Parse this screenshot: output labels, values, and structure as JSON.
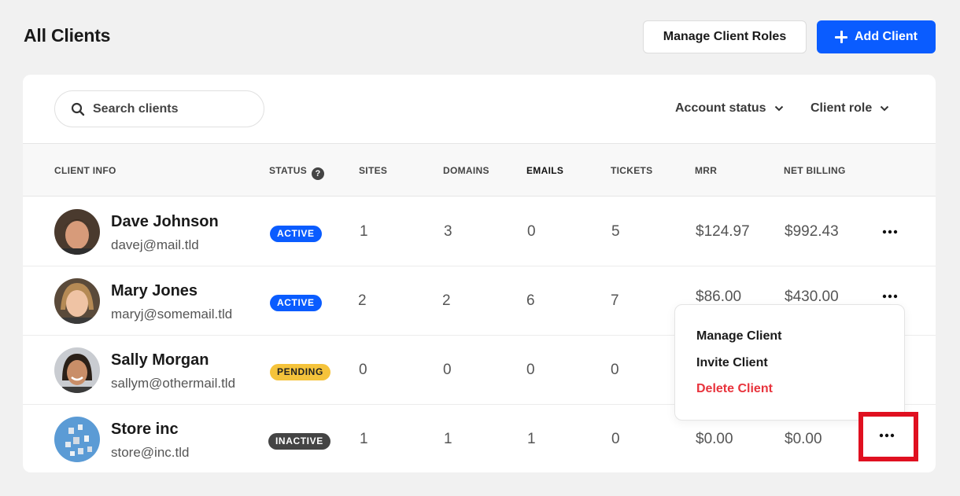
{
  "header": {
    "title": "All Clients",
    "manage_roles_label": "Manage Client Roles",
    "add_client_label": "Add Client"
  },
  "filters": {
    "search_placeholder": "Search clients",
    "account_status_label": "Account status",
    "client_role_label": "Client role"
  },
  "table": {
    "columns": [
      "CLIENT INFO",
      "STATUS",
      "SITES",
      "DOMAINS",
      "EMAILS",
      "TICKETS",
      "MRR",
      "NET BILLING"
    ],
    "rows": [
      {
        "name": "Dave Johnson",
        "email": "davej@mail.tld",
        "status": "ACTIVE",
        "sites": "1",
        "domains": "3",
        "emails": "0",
        "tickets": "5",
        "mrr": "$124.97",
        "net_billing": "$992.43"
      },
      {
        "name": "Mary Jones",
        "email": "maryj@somemail.tld",
        "status": "ACTIVE",
        "sites": "2",
        "domains": "2",
        "emails": "6",
        "tickets": "7",
        "mrr": "$86.00",
        "net_billing": "$430.00"
      },
      {
        "name": "Sally Morgan",
        "email": "sallym@othermail.tld",
        "status": "PENDING",
        "sites": "0",
        "domains": "0",
        "emails": "0",
        "tickets": "0",
        "mrr": "",
        "net_billing": ""
      },
      {
        "name": "Store inc",
        "email": "store@inc.tld",
        "status": "INACTIVE",
        "sites": "1",
        "domains": "1",
        "emails": "1",
        "tickets": "0",
        "mrr": "$0.00",
        "net_billing": "$0.00"
      }
    ]
  },
  "context_menu": {
    "items": [
      "Manage Client",
      "Invite Client",
      "Delete Client"
    ]
  },
  "colors": {
    "primary": "#0a5cff",
    "active": "#0a5cff",
    "pending": "#f5c33b",
    "inactive": "#444444",
    "danger": "#e8333c",
    "highlight": "#e01020"
  },
  "icons": {
    "add": "plus-icon",
    "search": "search-icon",
    "dropdown": "chevron-down-icon",
    "status_help": "help-icon",
    "row_actions": "more-icon"
  }
}
